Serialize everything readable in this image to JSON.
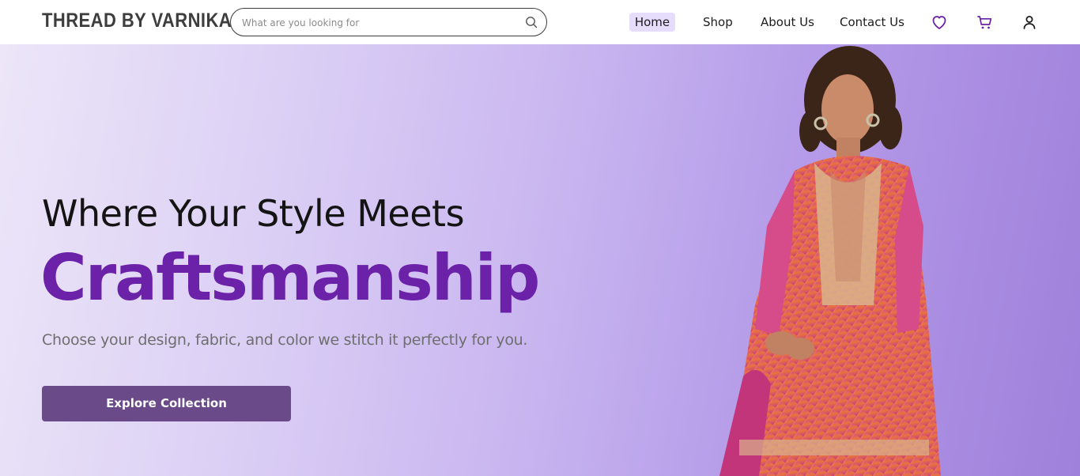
{
  "header": {
    "brand": "THREAD BY VARNIKA",
    "search_placeholder": "What are you looking for",
    "search_value": "",
    "nav": [
      {
        "label": "Home",
        "active": true
      },
      {
        "label": "Shop"
      },
      {
        "label": "About Us"
      },
      {
        "label": "Contact Us"
      }
    ],
    "icons": [
      "search-icon",
      "heart-icon",
      "cart-icon",
      "user-icon"
    ]
  },
  "hero": {
    "headline": "Where Your Style Meets",
    "highlight": "Craftsmanship",
    "tagline": "Choose your design, fabric, and color we stitch it perfectly for you.",
    "cta_label": "Explore Collection"
  },
  "colors": {
    "accent": "#6b21a8",
    "cta_bg": "#6b4a8a",
    "nav_active_bg": "#e6dcfb",
    "hero_gradient_start": "#ece6f8",
    "hero_gradient_end": "#9f80db"
  }
}
